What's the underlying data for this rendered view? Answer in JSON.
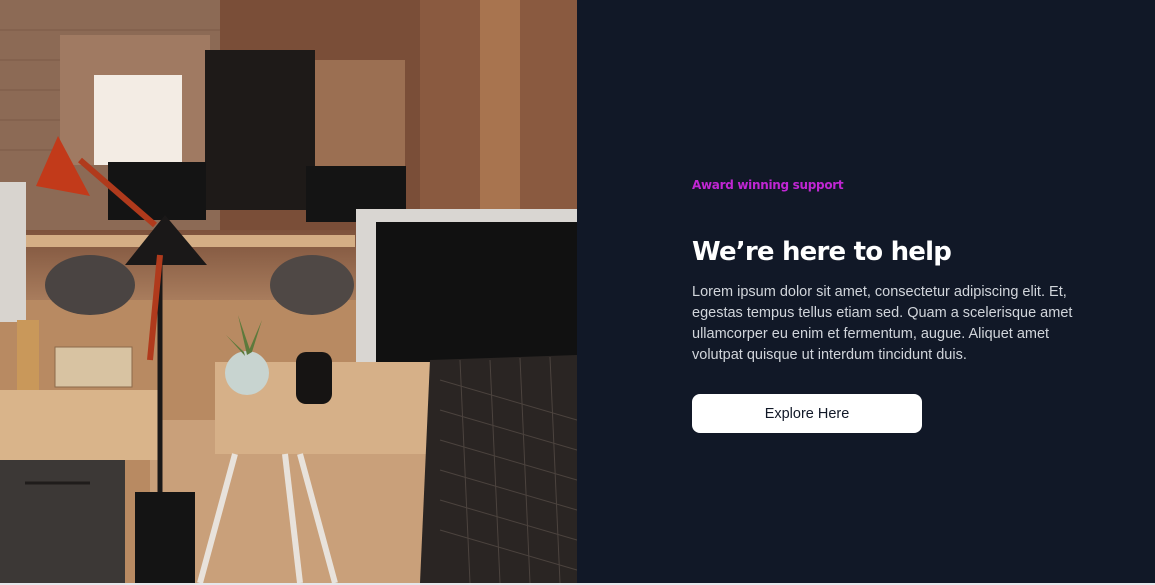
{
  "hero": {
    "image_alt": "Office workspace with desks, monitors and chairs",
    "eyebrow": "Award winning support",
    "heading": "We’re here to help",
    "description": "Lorem ipsum dolor sit amet, consectetur adipiscing elit. Et, egestas tempus tellus etiam sed. Quam a scelerisque amet ullamcorper eu enim et fermentum, augue. Aliquet amet volutpat quisque ut interdum tincidunt duis.",
    "cta_label": "Explore Here"
  },
  "colors": {
    "panel_bg": "#111827",
    "eyebrow": "#c026d3",
    "heading": "#ffffff",
    "body_text": "#d1d5db",
    "button_bg": "#ffffff",
    "button_text": "#111827"
  }
}
